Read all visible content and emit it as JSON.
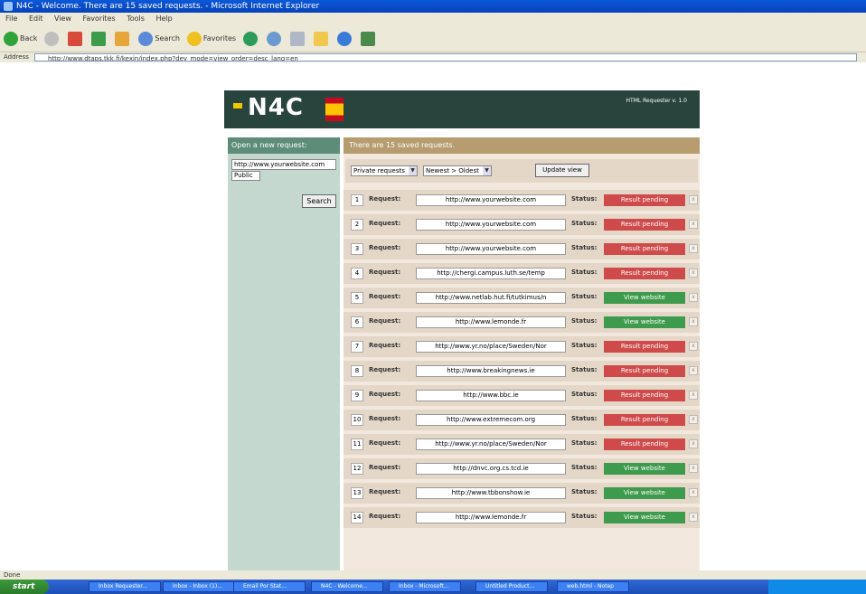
{
  "window": {
    "title": "N4C - Welcome. There are 15 saved requests. - Microsoft Internet Explorer"
  },
  "menu": [
    "File",
    "Edit",
    "View",
    "Favorites",
    "Tools",
    "Help"
  ],
  "toolbar": {
    "back": "Back",
    "search": "Search",
    "favorites": "Favorites"
  },
  "address": {
    "label": "Address",
    "url": "http://www.dtaps.tkk.fi/kexin/index.php?dev_mode=view_order=desc_lang=en"
  },
  "header": {
    "logo": "N4C",
    "version": "HTML Requester v. 1.0"
  },
  "sidebar": {
    "heading": "Open a new request:",
    "url_value": "http://www.yourwebsite.com",
    "visibility": "Public",
    "search_label": "Search"
  },
  "main": {
    "heading": "There are 15 saved requests.",
    "filter_type": "Private requests",
    "filter_order": "Newest > Oldest",
    "update_label": "Update view",
    "request_label": "Request:",
    "status_label": "Status:",
    "rows": [
      {
        "num": "1",
        "url": "http://www.yourwebsite.com",
        "status": "Result pending",
        "kind": "pending"
      },
      {
        "num": "2",
        "url": "http://www.yourwebsite.com",
        "status": "Result pending",
        "kind": "pending"
      },
      {
        "num": "3",
        "url": "http://www.yourwebsite.com",
        "status": "Result pending",
        "kind": "pending"
      },
      {
        "num": "4",
        "url": "http://chergi.campus.luth.se/temp",
        "status": "Result pending",
        "kind": "pending"
      },
      {
        "num": "5",
        "url": "http://www.netlab.hut.fi/tutkimus/n",
        "status": "View website",
        "kind": "view"
      },
      {
        "num": "6",
        "url": "http://www.lemonde.fr",
        "status": "View website",
        "kind": "view"
      },
      {
        "num": "7",
        "url": "http://www.yr.no/place/Sweden/Nor",
        "status": "Result pending",
        "kind": "pending"
      },
      {
        "num": "8",
        "url": "http://www.breakingnews.ie",
        "status": "Result pending",
        "kind": "pending"
      },
      {
        "num": "9",
        "url": "http://www.bbc.ie",
        "status": "Result pending",
        "kind": "pending"
      },
      {
        "num": "10",
        "url": "http://www.extremecom.org",
        "status": "Result pending",
        "kind": "pending"
      },
      {
        "num": "11",
        "url": "http://www.yr.no/place/Sweden/Nor",
        "status": "Result pending",
        "kind": "pending"
      },
      {
        "num": "12",
        "url": "http://dnvc.org.cs.tcd.ie",
        "status": "View website",
        "kind": "view"
      },
      {
        "num": "13",
        "url": "http://www.tbbonshow.ie",
        "status": "View website",
        "kind": "view"
      },
      {
        "num": "14",
        "url": "http://www.lemonde.fr",
        "status": "View website",
        "kind": "view"
      }
    ]
  },
  "statusbar": {
    "text": "Done"
  },
  "taskbar": {
    "start": "start",
    "tasks": [
      "Inbox Requester...",
      "Inbox - Inbox (1)...",
      "Email Por Stat...",
      "N4C - Welcome...",
      "Inbox - Microsoft...",
      "Untitled Product...",
      "web.html - Notep"
    ]
  }
}
